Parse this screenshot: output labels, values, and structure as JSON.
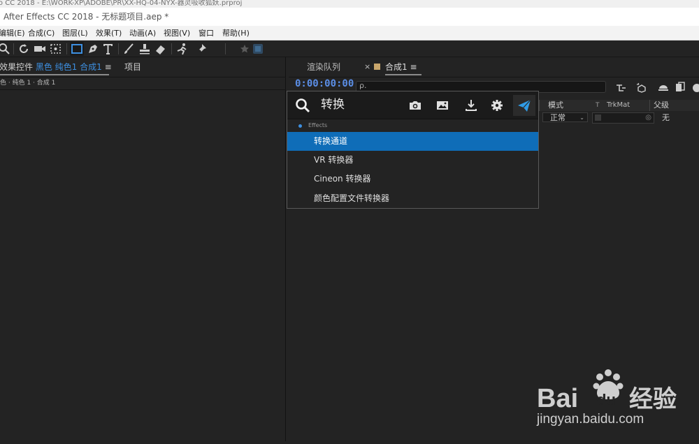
{
  "window": {
    "outer_title": "ro CC 2018 - E:\\WORK-XP\\ADOBE\\PR\\XX-HQ-04-NYX-器灵吸收狐妖.prproj",
    "app_title": "After Effects CC 2018 - 无标题项目.aep *"
  },
  "menu": [
    "编辑(E)",
    "合成(C)",
    "图层(L)",
    "效果(T)",
    "动画(A)",
    "视图(V)",
    "窗口",
    "帮助(H)"
  ],
  "left_panel": {
    "tab_prefix": "效果控件",
    "tab_layer": "黑色 纯色1 合成1",
    "tab_menu_icon": "≡",
    "tab_project": "项目",
    "sub_text": "色 · 纯色 1 · 合成 1"
  },
  "right_panel": {
    "tab_render_queue": "渲染队列",
    "tab_close": "×",
    "tab_comp": "合成1",
    "tab_menu_icon": "≡",
    "timecode": "0:00:00:00",
    "search_placeholder": "ρ.",
    "columns": {
      "mode": "模式",
      "t": "T",
      "trkmat": "TrkMat",
      "parent": "父级"
    },
    "row": {
      "mode_value": "正常",
      "parent_value": "无"
    }
  },
  "search_popup": {
    "query": "转换",
    "category": "Effects",
    "results": [
      "转换通道",
      "VR 转换器",
      "Cineon 转换器",
      "颜色配置文件转换器"
    ],
    "selected_index": 0,
    "icons": [
      "camera-icon",
      "image-icon",
      "download-icon",
      "gear-icon",
      "send-icon"
    ]
  },
  "watermark": {
    "brand_left": "Bai",
    "brand_du": "du",
    "brand_cn": "经验",
    "url": "jingyan.baidu.com"
  },
  "colors": {
    "accent_blue": "#0f6db8",
    "timecode_blue": "#5b8ee6",
    "comp_swatch": "#c9a66b",
    "popup_send": "#2f9be6"
  }
}
